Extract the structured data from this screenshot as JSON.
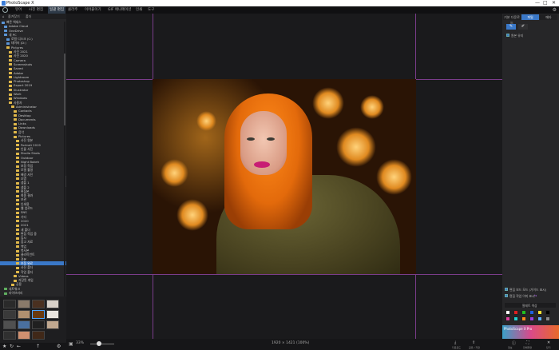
{
  "window": {
    "title": "PhotoScape X"
  },
  "menu": {
    "items": [
      "뷰어",
      "사진 편집",
      "일괄 편집",
      "콜라주",
      "이어붙이기",
      "GIF 애니메이션",
      "인쇄",
      "도구"
    ],
    "active_index": 2
  },
  "left_panel": {
    "tabs": [
      "즐겨찾기",
      "폴더"
    ],
    "tree": [
      {
        "label": "빠른 액세스",
        "indent": 0,
        "color": "blue"
      },
      {
        "label": "Adobe Cloud",
        "indent": 1,
        "color": "blue"
      },
      {
        "label": "OneDrive",
        "indent": 1,
        "color": "blue"
      },
      {
        "label": "내 PC",
        "indent": 1,
        "color": "blue"
      },
      {
        "label": "로컬 디스크 (C:)",
        "indent": 2,
        "color": "blue"
      },
      {
        "label": "데이터 (D:)",
        "indent": 2,
        "color": "blue"
      },
      {
        "label": "Pictures",
        "indent": 2,
        "color": "yellow"
      },
      {
        "label": "사진 2021",
        "indent": 3,
        "color": "yellow"
      },
      {
        "label": "사진 2020",
        "indent": 3,
        "color": "yellow"
      },
      {
        "label": "Camera",
        "indent": 3,
        "color": "yellow"
      },
      {
        "label": "Screenshots",
        "indent": 3,
        "color": "yellow"
      },
      {
        "label": "Saved",
        "indent": 3,
        "color": "yellow"
      },
      {
        "label": "Adobe",
        "indent": 3,
        "color": "yellow"
      },
      {
        "label": "Lightroom",
        "indent": 3,
        "color": "yellow"
      },
      {
        "label": "Photoshop",
        "indent": 3,
        "color": "yellow"
      },
      {
        "label": "Export 2019",
        "indent": 3,
        "color": "yellow"
      },
      {
        "label": "Illustrator",
        "indent": 3,
        "color": "yellow"
      },
      {
        "label": "Work",
        "indent": 3,
        "color": "yellow"
      },
      {
        "label": "Windows",
        "indent": 3,
        "color": "yellow"
      },
      {
        "label": "사용자",
        "indent": 3,
        "color": "yellow"
      },
      {
        "label": "Administrator",
        "indent": 4,
        "color": "yellow"
      },
      {
        "label": "Contacts",
        "indent": 5,
        "color": "yellow"
      },
      {
        "label": "Desktop",
        "indent": 5,
        "color": "yellow"
      },
      {
        "label": "Documents",
        "indent": 5,
        "color": "yellow"
      },
      {
        "label": "Links",
        "indent": 5,
        "color": "yellow"
      },
      {
        "label": "Downloads",
        "indent": 5,
        "color": "yellow"
      },
      {
        "label": "음악",
        "indent": 5,
        "color": "yellow"
      },
      {
        "label": "Pictures",
        "indent": 5,
        "color": "yellow"
      },
      {
        "label": "사진 원본",
        "indent": 6,
        "color": "yellow"
      },
      {
        "label": "Portrait 2019",
        "indent": 6,
        "color": "yellow"
      },
      {
        "label": "인물 사진",
        "indent": 6,
        "color": "yellow"
      },
      {
        "label": "Studio Shots",
        "indent": 6,
        "color": "yellow"
      },
      {
        "label": "Outdoor",
        "indent": 6,
        "color": "yellow"
      },
      {
        "label": "Night Bokeh",
        "indent": 6,
        "color": "yellow"
      },
      {
        "label": "보정 작업",
        "indent": 6,
        "color": "yellow"
      },
      {
        "label": "모델 촬영",
        "indent": 6,
        "color": "yellow"
      },
      {
        "label": "배경 사진",
        "indent": 6,
        "color": "yellow"
      },
      {
        "label": "조명",
        "indent": 6,
        "color": "yellow"
      },
      {
        "label": "샘플 1",
        "indent": 6,
        "color": "yellow"
      },
      {
        "label": "샘플 2",
        "indent": 6,
        "color": "yellow"
      },
      {
        "label": "편집본",
        "indent": 6,
        "color": "yellow"
      },
      {
        "label": "최종 결과",
        "indent": 6,
        "color": "yellow"
      },
      {
        "label": "보관",
        "indent": 6,
        "color": "yellow"
      },
      {
        "label": "인쇄용",
        "indent": 6,
        "color": "yellow"
      },
      {
        "label": "웹 업로드",
        "indent": 6,
        "color": "yellow"
      },
      {
        "label": "SNS",
        "indent": 6,
        "color": "yellow"
      },
      {
        "label": "기타",
        "indent": 6,
        "color": "yellow"
      },
      {
        "label": "2020",
        "indent": 6,
        "color": "yellow"
      },
      {
        "label": "2021",
        "indent": 6,
        "color": "yellow"
      },
      {
        "label": "새 폴더",
        "indent": 6,
        "color": "yellow"
      },
      {
        "label": "편집 작업 중",
        "indent": 6,
        "color": "yellow"
      },
      {
        "label": "임시",
        "indent": 6,
        "color": "yellow"
      },
      {
        "label": "참고 자료",
        "indent": 6,
        "color": "yellow"
      },
      {
        "label": "백업",
        "indent": 6,
        "color": "yellow"
      },
      {
        "label": "복사본",
        "indent": 6,
        "color": "yellow"
      },
      {
        "label": "클라이언트",
        "indent": 6,
        "color": "yellow"
      },
      {
        "label": "견본",
        "indent": 6,
        "color": "yellow"
      },
      {
        "label": "보정 완료",
        "indent": 6,
        "color": "yellow"
      },
      {
        "label": "사진 폴더",
        "indent": 6,
        "color": "yellow"
      },
      {
        "label": "작업 폴더",
        "indent": 6,
        "color": "yellow"
      },
      {
        "label": "Videos",
        "indent": 5,
        "color": "yellow"
      },
      {
        "label": "저장된 게임",
        "indent": 5,
        "color": "yellow"
      },
      {
        "label": "공용",
        "indent": 4,
        "color": "yellow"
      },
      {
        "label": "네트워크",
        "indent": 1,
        "color": "green"
      },
      {
        "label": "라이브러리",
        "indent": 1,
        "color": "green"
      }
    ],
    "selected_index": 57
  },
  "canvas": {
    "status": "1920 × 1421 (100%)",
    "zoom_label": "33%"
  },
  "right_panel": {
    "tabs": [
      "기본 다운로드",
      "파일",
      "메타"
    ],
    "active_tab": 1,
    "check1": "원본 유지",
    "check2": "편집 보드 모드 (가이드 표시)",
    "check3": "편집 작업 이미 표시",
    "palette_title": "팔레트 색상",
    "tile_text": "PhotoScape X Pro"
  },
  "bottom_right": {
    "actions": [
      "다운로드",
      "공유 / 저장",
      "정보",
      "전체화면",
      "닫기"
    ]
  },
  "colors": {
    "accent": "#3a78c8",
    "swatches": [
      "#ffffff",
      "#e02020",
      "#20c020",
      "#2060e0",
      "#ffe030",
      "#000000",
      "#e040a0",
      "#20d0d0",
      "#ff8a1a",
      "#9a40e0",
      "#60b0ff",
      "#888888"
    ]
  }
}
